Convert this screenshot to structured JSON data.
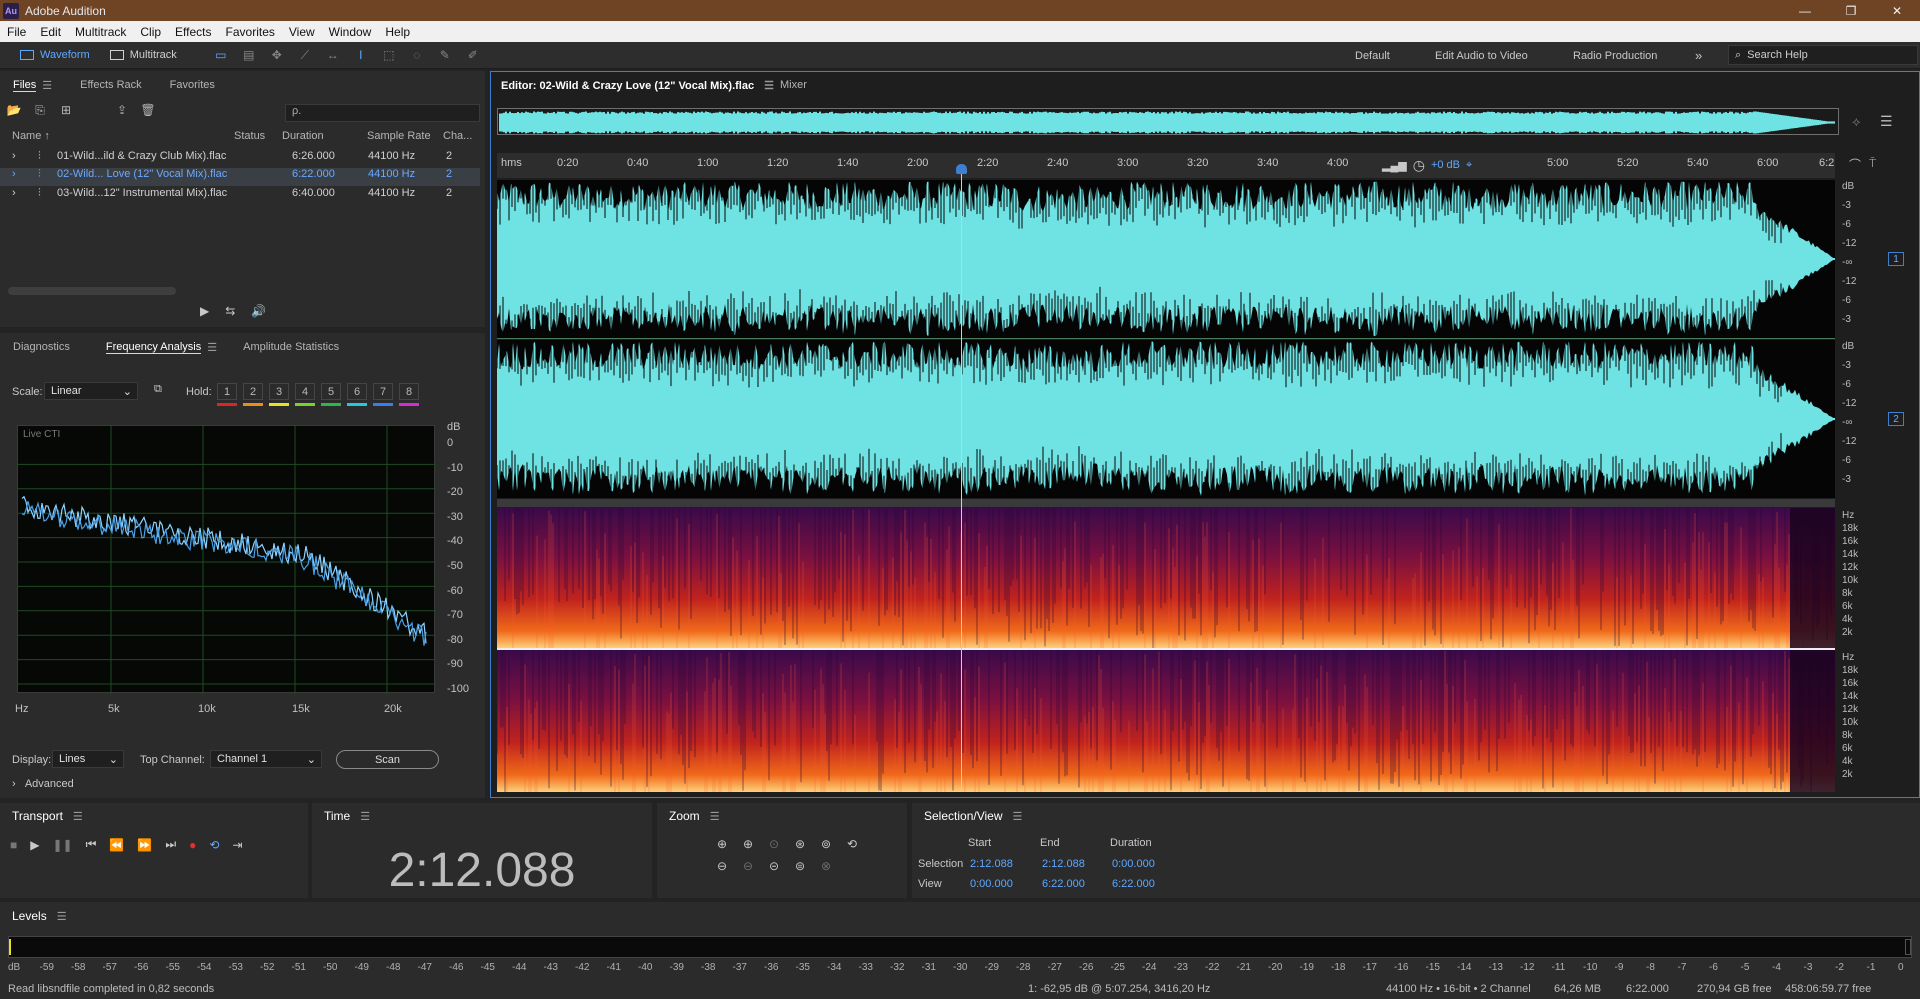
{
  "window": {
    "app_logo": "Au",
    "title": "Adobe Audition",
    "controls": [
      "—",
      "❐",
      "✕"
    ]
  },
  "menu": [
    "File",
    "Edit",
    "Multitrack",
    "Clip",
    "Effects",
    "Favorites",
    "View",
    "Window",
    "Help"
  ],
  "toolbar": {
    "waveform_label": "Waveform",
    "multitrack_label": "Multitrack",
    "workspaces": [
      "Default",
      "Edit Audio to Video",
      "Radio Production"
    ],
    "more_icon": "double-chevron-right-icon",
    "search_placeholder": "Search Help"
  },
  "files_panel": {
    "tabs": [
      "Files",
      "Effects Rack",
      "Favorites"
    ],
    "search_placeholder": "ρ.",
    "columns": [
      "Name ↑",
      "Status",
      "Duration",
      "Sample Rate",
      "Cha..."
    ],
    "rows": [
      {
        "name": "01-Wild...ild & Crazy Club Mix).flac",
        "status": "",
        "duration": "6:26.000",
        "rate": "44100 Hz",
        "channels": "2"
      },
      {
        "name": "02-Wild... Love (12\" Vocal Mix).flac",
        "status": "",
        "duration": "6:22.000",
        "rate": "44100 Hz",
        "channels": "2"
      },
      {
        "name": "03-Wild...12\" Instrumental Mix).flac",
        "status": "",
        "duration": "6:40.000",
        "rate": "44100 Hz",
        "channels": "2"
      }
    ],
    "selected_row": 1
  },
  "analysis_panel": {
    "tabs": [
      "Diagnostics",
      "Frequency Analysis",
      "Amplitude Statistics"
    ],
    "scale_label": "Scale:",
    "scale_value": "Linear",
    "hold_label": "Hold:",
    "hold_buttons": [
      "1",
      "2",
      "3",
      "4",
      "5",
      "6",
      "7",
      "8"
    ],
    "hold_colors": [
      "#e02424",
      "#f08a1c",
      "#e8e020",
      "#7ad12a",
      "#2ab84a",
      "#22c8e0",
      "#3a7cf0",
      "#d82ad8"
    ],
    "live_label": "Live CTI",
    "db_unit": "dB",
    "db_ticks": [
      "0",
      "-10",
      "-20",
      "-30",
      "-40",
      "-50",
      "-60",
      "-70",
      "-80",
      "-90",
      "-100"
    ],
    "hz_ticks": [
      "Hz",
      "5k",
      "10k",
      "15k",
      "20k"
    ],
    "display_label": "Display:",
    "display_value": "Lines",
    "top_channel_label": "Top Channel:",
    "top_channel_value": "Channel 1",
    "scan_label": "Scan",
    "advanced_label": "Advanced"
  },
  "editor": {
    "tab_title": "Editor: 02-Wild & Crazy Love (12\" Vocal Mix).flac",
    "mixer_tab": "Mixer",
    "ruler_unit": "hms",
    "ruler_ticks": [
      "0:20",
      "0:40",
      "1:00",
      "1:20",
      "1:40",
      "2:00",
      "2:20",
      "2:40",
      "3:00",
      "3:20",
      "3:40",
      "4:00",
      "5:00",
      "5:20",
      "5:40",
      "6:00",
      "6:2"
    ],
    "volume_label": "+0 dB",
    "db_scale": [
      "dB",
      "-3",
      "-6",
      "-12",
      "-∞",
      "-12",
      "-6",
      "-3"
    ],
    "hz_scale": [
      "Hz",
      "18k",
      "16k",
      "14k",
      "12k",
      "10k",
      "8k",
      "6k",
      "4k",
      "2k"
    ],
    "channel_numbers": [
      "1",
      "2"
    ],
    "waveform_color": "#6fe3e3",
    "playhead_color": "#d8e060",
    "playhead_fraction": 0.3465
  },
  "transport": {
    "title": "Transport",
    "buttons": [
      "■",
      "▶",
      "❚❚",
      "⏮",
      "⏪",
      "⏩",
      "⏭",
      "●",
      "⟲",
      "⇥"
    ]
  },
  "time_panel": {
    "title": "Time",
    "value": "2:12.088"
  },
  "zoom_panel": {
    "title": "Zoom"
  },
  "selection_view": {
    "title": "Selection/View",
    "headers": [
      "Start",
      "End",
      "Duration"
    ],
    "selection_label": "Selection",
    "selection": [
      "2:12.088",
      "2:12.088",
      "0:00.000"
    ],
    "view_label": "View",
    "view": [
      "0:00.000",
      "6:22.000",
      "6:22.000"
    ]
  },
  "levels": {
    "title": "Levels",
    "ticks": [
      "dB",
      "-59",
      "-58",
      "-57",
      "-56",
      "-55",
      "-54",
      "-53",
      "-52",
      "-51",
      "-50",
      "-49",
      "-48",
      "-47",
      "-46",
      "-45",
      "-44",
      "-43",
      "-42",
      "-41",
      "-40",
      "-39",
      "-38",
      "-37",
      "-36",
      "-35",
      "-34",
      "-33",
      "-32",
      "-31",
      "-30",
      "-29",
      "-28",
      "-27",
      "-26",
      "-25",
      "-24",
      "-23",
      "-22",
      "-21",
      "-20",
      "-19",
      "-18",
      "-17",
      "-16",
      "-15",
      "-14",
      "-13",
      "-12",
      "-11",
      "-10",
      "-9",
      "-8",
      "-7",
      "-6",
      "-5",
      "-4",
      "-3",
      "-2",
      "-1",
      "0"
    ]
  },
  "status": {
    "message": "Read libsndfile completed in 0,82 seconds",
    "cursor_info": "1: -62,95 dB @ 5:07.254, 3416,20 Hz",
    "format": "44100 Hz • 16-bit • 2 Channel",
    "size": "64,26 MB",
    "duration": "6:22.000",
    "free_space": "270,94 GB free",
    "free_time": "458:06:59.77 free"
  }
}
